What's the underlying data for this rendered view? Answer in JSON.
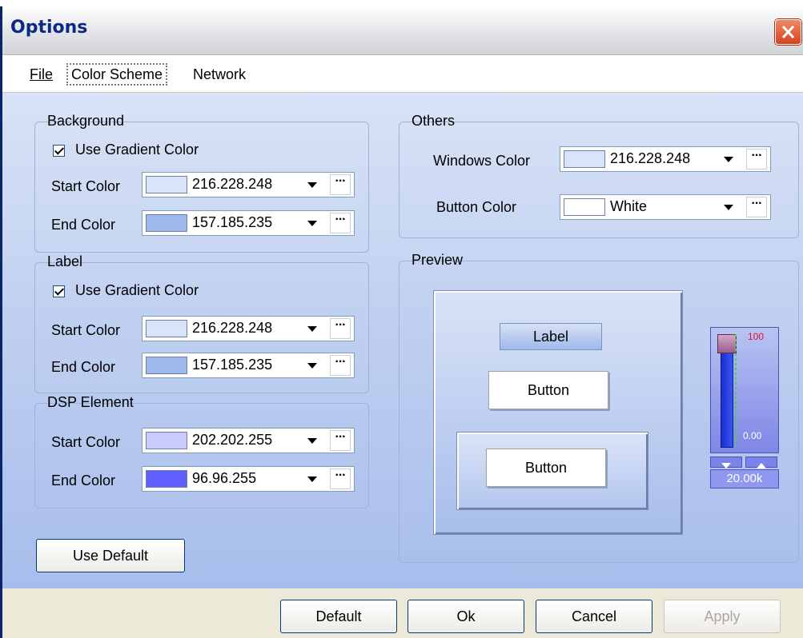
{
  "window": {
    "title": "Options"
  },
  "menu": {
    "file": "File",
    "color_scheme": "Color Scheme",
    "network": "Network"
  },
  "background_group": {
    "title": "Background",
    "gradient_label": "Use Gradient Color",
    "gradient_checked": true,
    "start_label": "Start Color",
    "start_value": "216.228.248",
    "start_color": "#d8e4f8",
    "end_label": "End Color",
    "end_value": "157.185.235",
    "end_color": "#9db9eb"
  },
  "label_group": {
    "title": "Label",
    "gradient_label": "Use Gradient Color",
    "gradient_checked": true,
    "start_label": "Start Color",
    "start_value": "216.228.248",
    "start_color": "#d8e4f8",
    "end_label": "End Color",
    "end_value": "157.185.235",
    "end_color": "#9db9eb"
  },
  "dsp_group": {
    "title": "DSP Element",
    "start_label": "Start Color",
    "start_value": "202.202.255",
    "start_color": "#cacaff",
    "end_label": "End Color",
    "end_value": "96.96.255",
    "end_color": "#6060ff"
  },
  "others_group": {
    "title": "Others",
    "windows_label": "Windows Color",
    "windows_value": "216.228.248",
    "windows_color": "#d8e4f8",
    "button_label": "Button Color",
    "button_value": "White",
    "button_color": "#ffffff"
  },
  "preview_group": {
    "title": "Preview",
    "label_text": "Label",
    "button1": "Button",
    "button2": "Button",
    "slider_max": "100",
    "slider_min": "0.00",
    "slider_value": "20.00k"
  },
  "use_default_button": "Use Default",
  "footer": {
    "default": "Default",
    "ok": "Ok",
    "cancel": "Cancel",
    "apply": "Apply"
  }
}
